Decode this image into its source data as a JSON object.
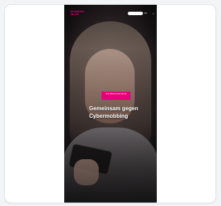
{
  "header": {
    "logo_text": "MOBBING\nHILFE",
    "primary_button_label": "",
    "language_label": "EN",
    "close_glyph": "×"
  },
  "hero": {
    "badge_text": "ICH BRAUCHE HILFE",
    "headline_line1": "Gemeinsam gegen",
    "headline_line2": "Cybermobbing"
  },
  "colors": {
    "brand_magenta": "#e6007e",
    "card_background": "#ffffff",
    "page_background": "#f3f4f6"
  },
  "icons": {
    "close": "close-icon"
  }
}
